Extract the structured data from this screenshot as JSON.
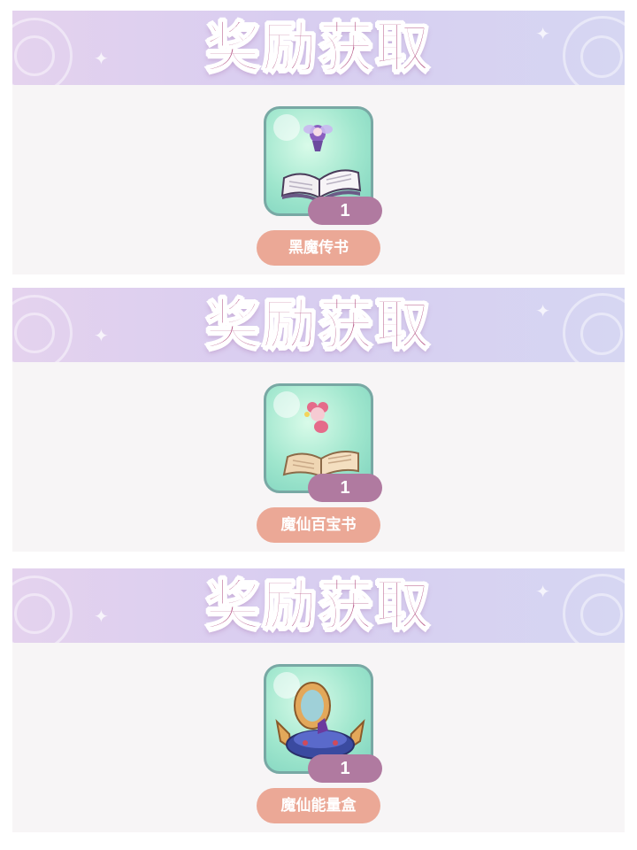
{
  "panels": [
    {
      "banner_title": "奖励获取",
      "item": {
        "icon": "dark-magic-book-icon",
        "count": "1",
        "name": "黑魔传书"
      }
    },
    {
      "banner_title": "奖励获取",
      "item": {
        "icon": "fairy-treasure-book-icon",
        "count": "1",
        "name": "魔仙百宝书"
      }
    },
    {
      "banner_title": "奖励获取",
      "item": {
        "icon": "fairy-energy-box-icon",
        "count": "1",
        "name": "魔仙能量盒"
      }
    }
  ],
  "colors": {
    "title": "#b24f81",
    "count_badge": "#b07aa0",
    "name_pill": "#eba896",
    "card_border": "#78a8a4",
    "banner_start": "#e4d2ee",
    "banner_end": "#d6d6f2"
  }
}
